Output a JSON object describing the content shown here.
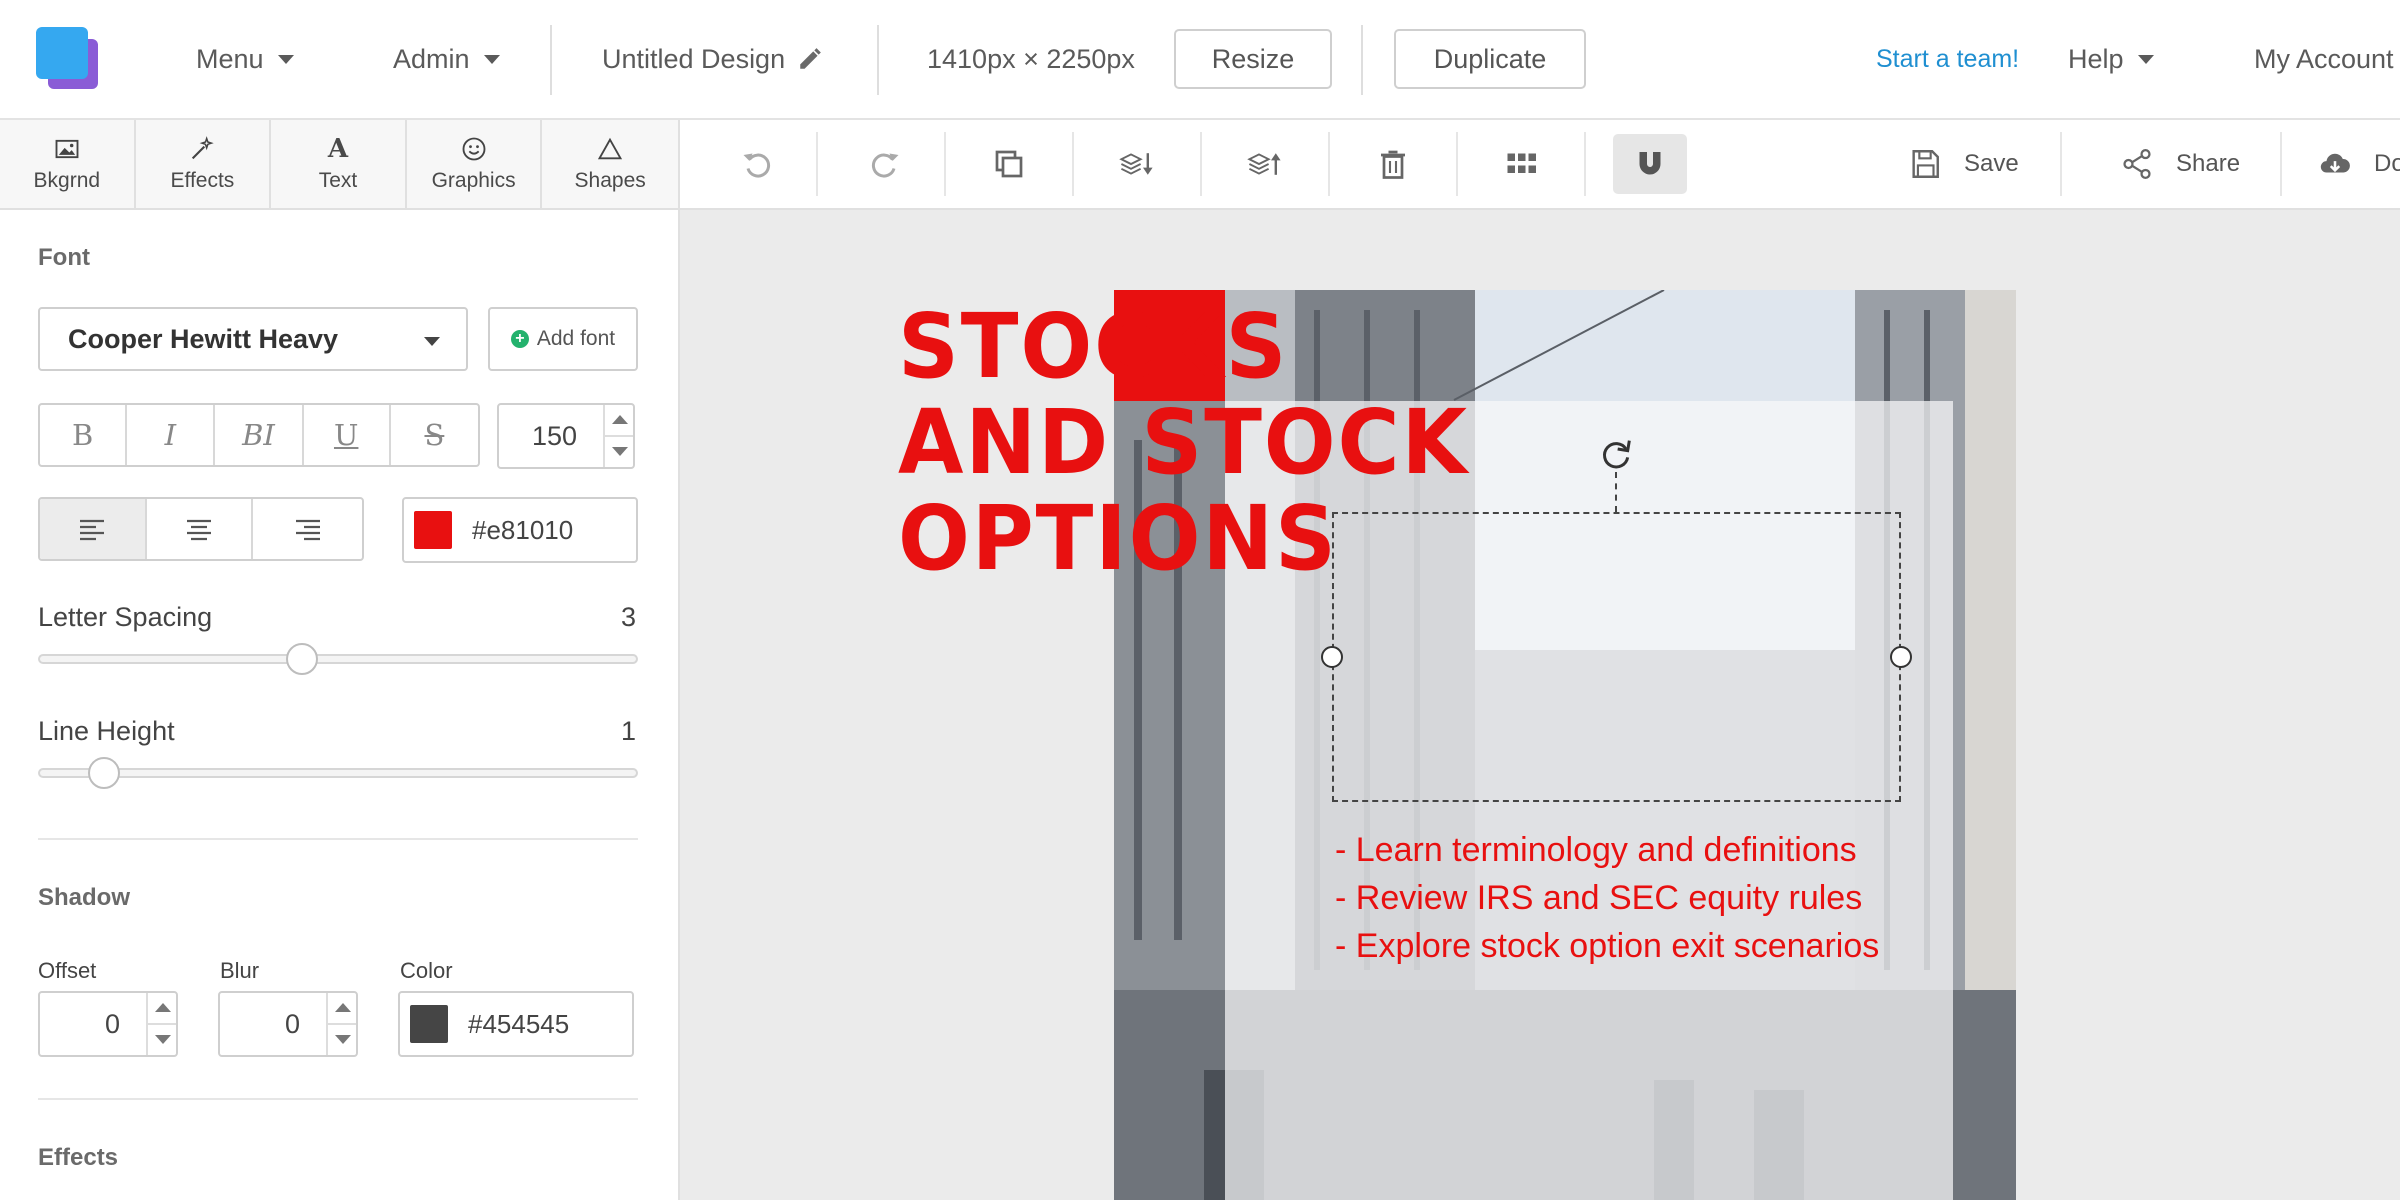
{
  "app": {
    "design_title": "Untitled Design",
    "dimensions": "1410px × 2250px",
    "resize_label": "Resize",
    "duplicate_label": "Duplicate",
    "menu_label": "Menu",
    "admin_label": "Admin",
    "start_team_label": "Start a team!",
    "help_label": "Help",
    "account_label": "My Account"
  },
  "tool_tabs": [
    {
      "label": "Bkgrnd",
      "icon": "image-icon"
    },
    {
      "label": "Effects",
      "icon": "magic-wand-icon"
    },
    {
      "label": "Text",
      "icon": "text-icon"
    },
    {
      "label": "Graphics",
      "icon": "smiley-icon"
    },
    {
      "label": "Shapes",
      "icon": "triangle-icon"
    }
  ],
  "actions": {
    "save_label": "Save",
    "share_label": "Share",
    "download_label": "Do"
  },
  "panel": {
    "font_title": "Font",
    "font_name": "Cooper Hewitt Heavy",
    "add_font_label": "Add font",
    "style_buttons": [
      "B",
      "I",
      "BI",
      "U",
      "S"
    ],
    "font_size": "150",
    "text_color": "#e81010",
    "letter_spacing_label": "Letter Spacing",
    "letter_spacing_value": "3",
    "letter_spacing_fraction": 0.44,
    "line_height_label": "Line Height",
    "line_height_value": "1",
    "line_height_fraction": 0.11,
    "shadow_title": "Shadow",
    "offset_label": "Offset",
    "offset_value": "0",
    "blur_label": "Blur",
    "blur_value": "0",
    "color_label": "Color",
    "shadow_color": "#454545",
    "effects_title": "Effects"
  },
  "design": {
    "headline": [
      "STOCKS",
      "AND STOCK",
      "OPTIONS"
    ],
    "bullets": [
      "- Learn terminology and definitions",
      "- Review IRS and SEC equity rules",
      "- Explore stock option exit scenarios"
    ],
    "accent_color": "#e81010"
  },
  "colors": {
    "link": "#1f8fd1",
    "logo_primary": "#35a8f0",
    "logo_secondary": "#8a5cd6",
    "add_font_dot": "#23b26d"
  }
}
